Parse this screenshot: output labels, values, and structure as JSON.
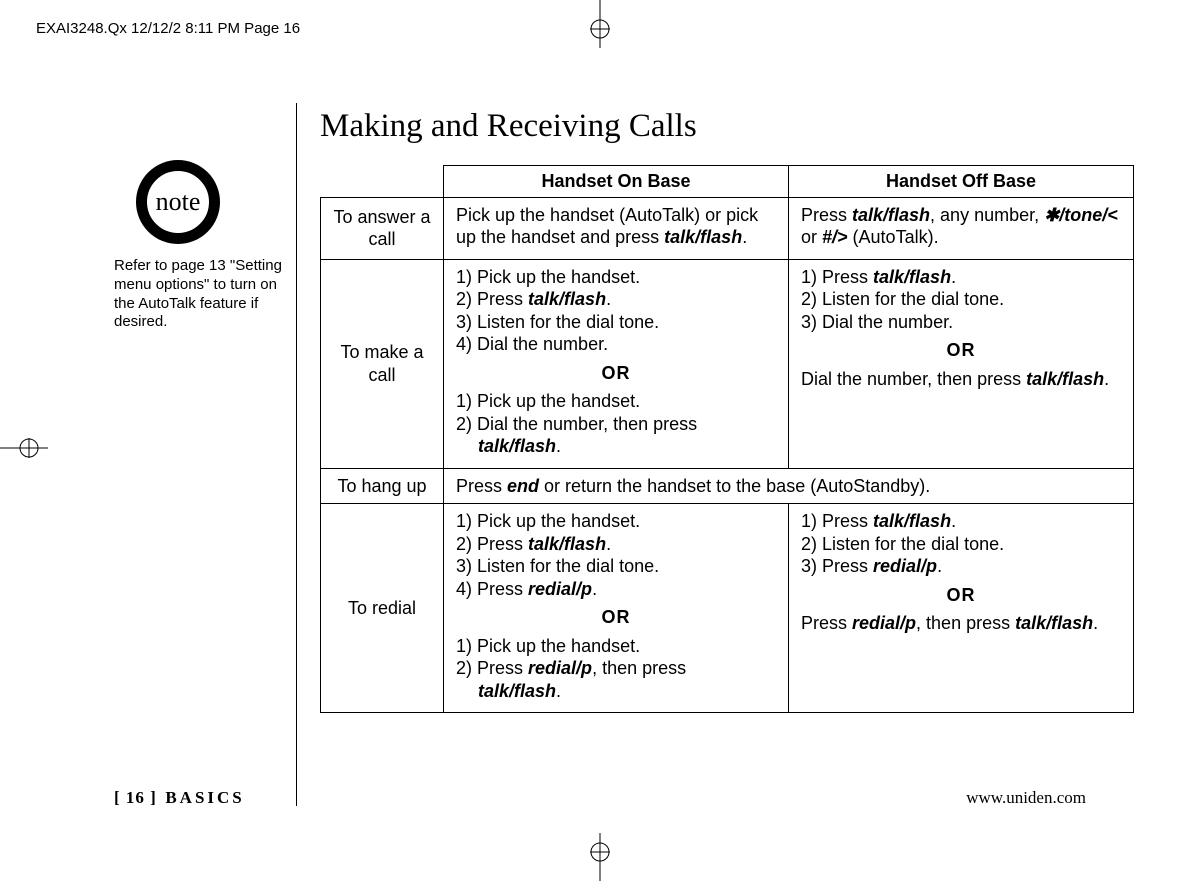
{
  "meta": {
    "slug": "EXAI3248.Qx  12/12/2  8:11 PM  Page 16"
  },
  "title": "Making and Receiving Calls",
  "note": {
    "label": "note",
    "text": "Refer to page 13 \"Setting menu options\" to turn on the AutoTalk feature if desired."
  },
  "table": {
    "header_col1": "Handset On Base",
    "header_col2": "Handset Off Base",
    "rows": {
      "answer": {
        "label": "To answer a call",
        "on_pre": "Pick up the handset (AutoTalk) or pick up the handset and press ",
        "on_em": "talk/flash",
        "on_post": ".",
        "off_pre": "Press ",
        "off_em1": "talk/flash",
        "off_mid1": ", any number, ",
        "off_em2": "✱/tone/<",
        "off_mid2": " or ",
        "off_em3": "#/>",
        "off_post": " (AutoTalk)."
      },
      "make": {
        "label": "To make a call",
        "on_s1": "1) Pick up the handset.",
        "on_s2a": "2) Press ",
        "on_s2b": "talk/flash",
        "on_s2c": ".",
        "on_s3": "3) Listen for the dial tone.",
        "on_s4": "4) Dial the number.",
        "or": "OR",
        "on_s5": "1) Pick up the handset.",
        "on_s6a": "2) Dial the number, then press",
        "on_s6b": "talk/flash",
        "on_s6c": ".",
        "off_s1a": "1) Press ",
        "off_s1b": "talk/flash",
        "off_s1c": ".",
        "off_s2": "2) Listen for the dial tone.",
        "off_s3": "3) Dial the number.",
        "off_s4a": "Dial the number, then press ",
        "off_s4b": "talk/flash",
        "off_s4c": "."
      },
      "hang": {
        "label": "To hang up",
        "text_a": "Press ",
        "text_b": "end",
        "text_c": " or return the handset to the base (AutoStandby)."
      },
      "redial": {
        "label": "To redial",
        "on_s1": "1) Pick up the handset.",
        "on_s2a": "2) Press ",
        "on_s2b": "talk/flash",
        "on_s2c": ".",
        "on_s3": "3) Listen for the dial tone.",
        "on_s4a": "4) Press ",
        "on_s4b": "redial/p",
        "on_s4c": ".",
        "or": "OR",
        "on_s5": "1) Pick up the handset.",
        "on_s6a": "2) Press ",
        "on_s6b": "redial/p",
        "on_s6c": ", then press",
        "on_s7b": "talk/flash",
        "on_s7c": ".",
        "off_s1a": "1) Press ",
        "off_s1b": "talk/flash",
        "off_s1c": ".",
        "off_s2": "2) Listen for the dial tone.",
        "off_s3a": "3) Press ",
        "off_s3b": "redial/p",
        "off_s3c": ".",
        "off_s4a": "Press ",
        "off_s4b": "redial/p",
        "off_s4c": ", then press ",
        "off_s4d": "talk/flash",
        "off_s4e": "."
      }
    }
  },
  "footer": {
    "page_open": "[",
    "page_num": "16",
    "page_close": "]",
    "section": "BASICS",
    "url": "www.uniden.com"
  }
}
